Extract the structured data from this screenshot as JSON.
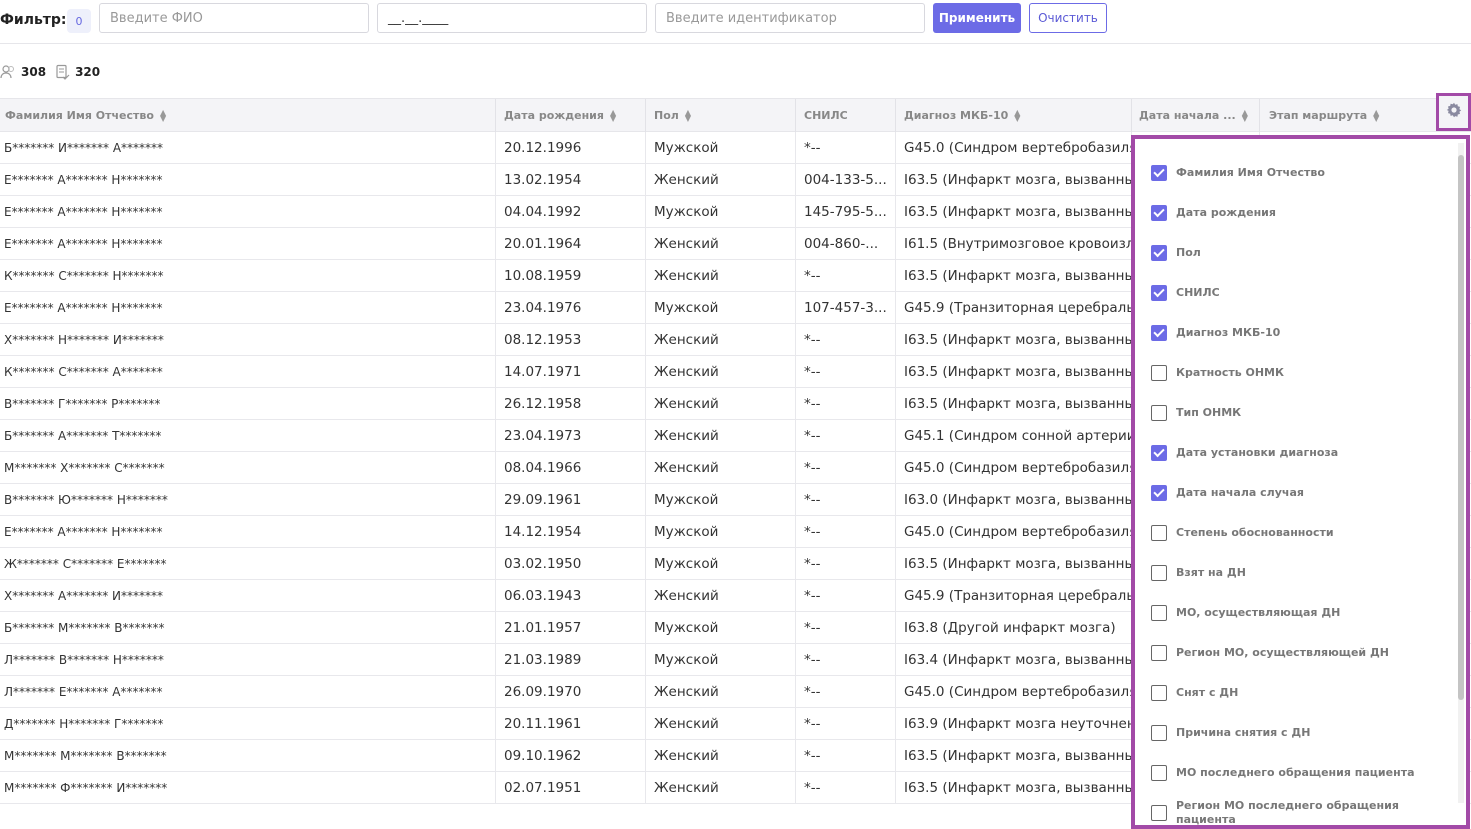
{
  "filter": {
    "label": "Фильтр:",
    "count": "0",
    "fio_placeholder": "Введите ФИО",
    "date_mask": "__.__.____",
    "ident_placeholder": "Введите идентификатор",
    "apply_label": "Применить",
    "clear_label": "Очистить"
  },
  "stats": {
    "patients": "308",
    "records": "320"
  },
  "columns": [
    "Фамилия Имя Отчество",
    "Дата рождения",
    "Пол",
    "СНИЛС",
    "Диагноз МКБ-10",
    "Дата начала ...",
    "Этап маршрута"
  ],
  "rows": [
    {
      "fio": "Б******* И******* А*******",
      "dob": "20.12.1996",
      "sex": "Мужской",
      "snils": "*--",
      "dx": "G45.0 (Синдром вертебробазиля"
    },
    {
      "fio": "Е******* А******* Н*******",
      "dob": "13.02.1954",
      "sex": "Женский",
      "snils": "004-133-5...",
      "dx": "I63.5 (Инфаркт мозга, вызванны"
    },
    {
      "fio": "Е******* А******* Н*******",
      "dob": "04.04.1992",
      "sex": "Мужской",
      "snils": "145-795-5...",
      "dx": "I63.5 (Инфаркт мозга, вызванны"
    },
    {
      "fio": "Е******* А******* Н*******",
      "dob": "20.01.1964",
      "sex": "Женский",
      "snils": "004-860-...",
      "dx": "I61.5 (Внутримозговое кровоизл"
    },
    {
      "fio": "К******* С******* Н*******",
      "dob": "10.08.1959",
      "sex": "Женский",
      "snils": "*--",
      "dx": "I63.5 (Инфаркт мозга, вызванны"
    },
    {
      "fio": "Е******* А******* Н*******",
      "dob": "23.04.1976",
      "sex": "Мужской",
      "snils": "107-457-3...",
      "dx": "G45.9 (Транзиторная церебралы"
    },
    {
      "fio": "Х******* Н******* И*******",
      "dob": "08.12.1953",
      "sex": "Женский",
      "snils": "*--",
      "dx": "I63.5 (Инфаркт мозга, вызванны"
    },
    {
      "fio": "К******* С******* А*******",
      "dob": "14.07.1971",
      "sex": "Женский",
      "snils": "*--",
      "dx": "I63.5 (Инфаркт мозга, вызванны"
    },
    {
      "fio": "В******* Г******* Р*******",
      "dob": "26.12.1958",
      "sex": "Женский",
      "snils": "*--",
      "dx": "I63.5 (Инфаркт мозга, вызванны"
    },
    {
      "fio": "Б******* А******* Т*******",
      "dob": "23.04.1973",
      "sex": "Женский",
      "snils": "*--",
      "dx": "G45.1 (Синдром сонной артерии"
    },
    {
      "fio": "М******* Х******* С*******",
      "dob": "08.04.1966",
      "sex": "Женский",
      "snils": "*--",
      "dx": "G45.0 (Синдром вертебробазиля"
    },
    {
      "fio": "В******* Ю******* Н*******",
      "dob": "29.09.1961",
      "sex": "Мужской",
      "snils": "*--",
      "dx": "I63.0 (Инфаркт мозга, вызванны"
    },
    {
      "fio": "Е******* А******* Н*******",
      "dob": "14.12.1954",
      "sex": "Мужской",
      "snils": "*--",
      "dx": "G45.0 (Синдром вертебробазиля"
    },
    {
      "fio": "Ж******* С******* Е*******",
      "dob": "03.02.1950",
      "sex": "Мужской",
      "snils": "*--",
      "dx": "I63.5 (Инфаркт мозга, вызванны"
    },
    {
      "fio": "Х******* А******* И*******",
      "dob": "06.03.1943",
      "sex": "Женский",
      "snils": "*--",
      "dx": "G45.9 (Транзиторная церебралы"
    },
    {
      "fio": "Б******* М******* В*******",
      "dob": "21.01.1957",
      "sex": "Мужской",
      "snils": "*--",
      "dx": "I63.8 (Другой инфаркт мозга)"
    },
    {
      "fio": "Л******* В******* Н*******",
      "dob": "21.03.1989",
      "sex": "Мужской",
      "snils": "*--",
      "dx": "I63.4 (Инфаркт мозга, вызванны"
    },
    {
      "fio": "Л******* Е******* А*******",
      "dob": "26.09.1970",
      "sex": "Женский",
      "snils": "*--",
      "dx": "G45.0 (Синдром вертебробазиля"
    },
    {
      "fio": "Д******* Н******* Г*******",
      "dob": "20.11.1961",
      "sex": "Женский",
      "snils": "*--",
      "dx": "I63.9 (Инфаркт мозга неуточнен"
    },
    {
      "fio": "М******* М******* В*******",
      "dob": "09.10.1962",
      "sex": "Женский",
      "snils": "*--",
      "dx": "I63.5 (Инфаркт мозга, вызванны"
    },
    {
      "fio": "М******* Ф******* И*******",
      "dob": "02.07.1951",
      "sex": "Женский",
      "snils": "*--",
      "dx": "I63.5 (Инфаркт мозга, вызванны"
    }
  ],
  "column_settings": [
    {
      "label": "Фамилия Имя Отчество",
      "checked": true
    },
    {
      "label": "Дата рождения",
      "checked": true
    },
    {
      "label": "Пол",
      "checked": true
    },
    {
      "label": "СНИЛС",
      "checked": true
    },
    {
      "label": "Диагноз МКБ-10",
      "checked": true
    },
    {
      "label": "Кратность ОНМК",
      "checked": false
    },
    {
      "label": "Тип ОНМК",
      "checked": false
    },
    {
      "label": "Дата установки диагноза",
      "checked": true
    },
    {
      "label": "Дата начала случая",
      "checked": true
    },
    {
      "label": "Степень обоснованности",
      "checked": false
    },
    {
      "label": "Взят на ДН",
      "checked": false
    },
    {
      "label": "МО, осуществляющая ДН",
      "checked": false
    },
    {
      "label": "Регион МО, осуществляющей ДН",
      "checked": false
    },
    {
      "label": "Снят с ДН",
      "checked": false
    },
    {
      "label": "Причина снятия с ДН",
      "checked": false
    },
    {
      "label": "МО последнего обращения пациента",
      "checked": false
    },
    {
      "label": "Регион МО последнего обращения пациента",
      "checked": false
    }
  ],
  "colors": {
    "accent": "#6c6be6",
    "highlight_border": "#a24aa7"
  }
}
